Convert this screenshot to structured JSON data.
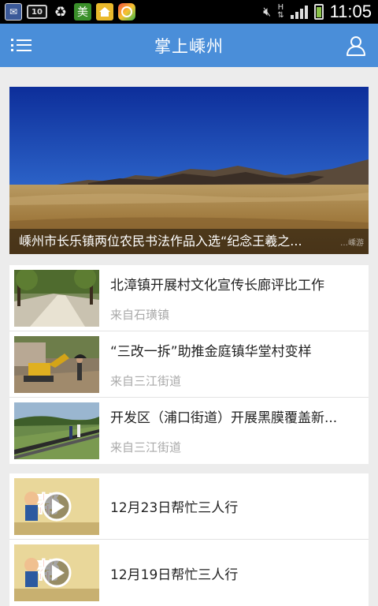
{
  "status_bar": {
    "icons": [
      "mail-icon",
      "sim-icon",
      "recycle-icon",
      "meituan-app-icon",
      "home-app-icon",
      "ball-app-icon"
    ],
    "sim_label": "10",
    "mei_label": "美",
    "network_label": "H",
    "time": "11:05"
  },
  "header": {
    "title": "掌上嵊州",
    "menu_icon": "list-menu-icon",
    "user_icon": "user-icon",
    "bar_color": "#4a8ed9"
  },
  "hero": {
    "caption": "嵊州市长乐镇两位农民书法作品入选“纪念王羲之...",
    "watermark": "…嵊游"
  },
  "news": [
    {
      "title": "北漳镇开展村文化宣传长廊评比工作",
      "source": "来自石璜镇",
      "thumb": "courtyard-photo"
    },
    {
      "title": "“三改一拆”助推金庭镇华堂村变样",
      "source": "来自三江街道",
      "thumb": "excavator-photo"
    },
    {
      "title": "开发区（浦口街道）开展黑膜覆盖新...",
      "source": "来自三江街道",
      "thumb": "field-photo"
    }
  ],
  "videos": [
    {
      "title": "12月23日帮忙三人行",
      "thumb": "video-thumb-play-icon"
    },
    {
      "title": "12月19日帮忙三人行",
      "thumb": "video-thumb-play-icon"
    }
  ]
}
